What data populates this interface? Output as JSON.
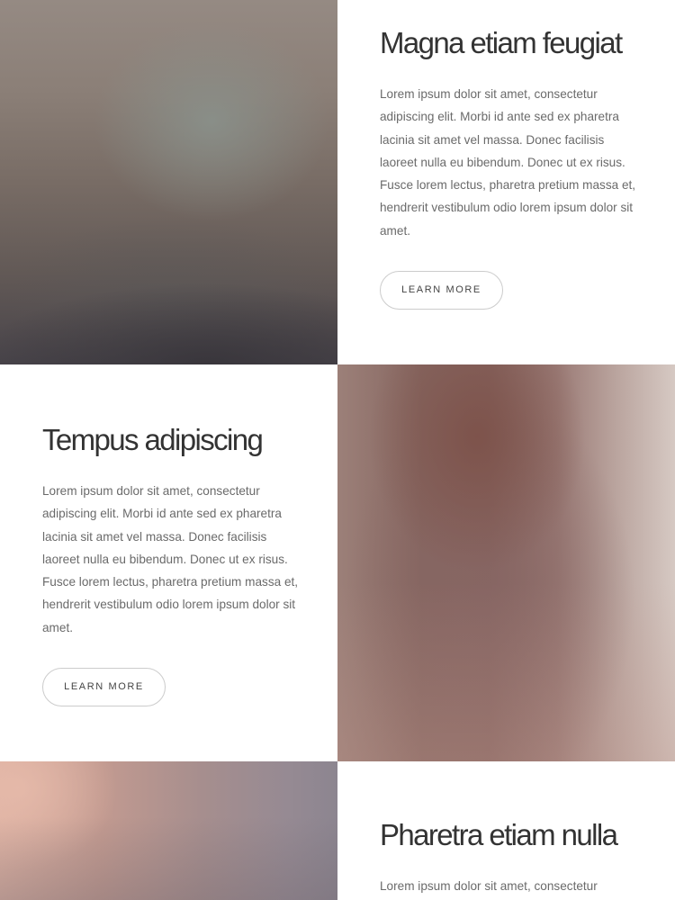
{
  "sections": [
    {
      "heading": "Magna etiam feugiat",
      "body": "Lorem ipsum dolor sit amet, consectetur adipiscing elit. Morbi id ante sed ex pharetra lacinia sit amet vel massa. Donec facilisis laoreet nulla eu bibendum. Donec ut ex risus. Fusce lorem lectus, pharetra pretium massa et, hendrerit vestibulum odio lorem ipsum dolor sit amet.",
      "button": "LEARN MORE"
    },
    {
      "heading": "Tempus adipiscing",
      "body": "Lorem ipsum dolor sit amet, consectetur adipiscing elit. Morbi id ante sed ex pharetra lacinia sit amet vel massa. Donec facilisis laoreet nulla eu bibendum. Donec ut ex risus. Fusce lorem lectus, pharetra pretium massa et, hendrerit vestibulum odio lorem ipsum dolor sit amet.",
      "button": "LEARN MORE"
    },
    {
      "heading": "Pharetra etiam nulla",
      "body": "Lorem ipsum dolor sit amet, consectetur"
    }
  ]
}
